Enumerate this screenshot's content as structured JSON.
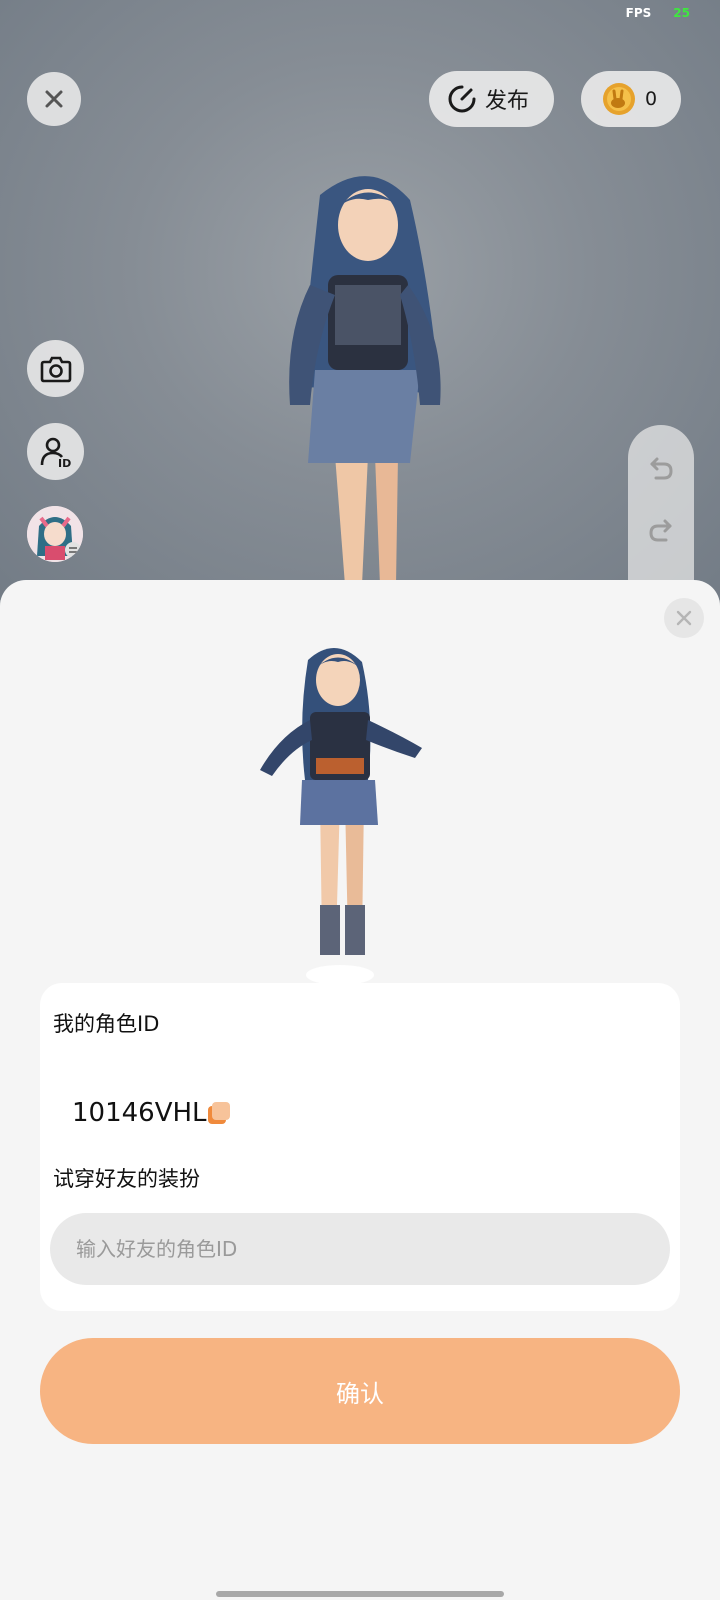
{
  "status": {
    "fps_label": "FPS",
    "fps_value": "25"
  },
  "topbar": {
    "close_icon": "close-icon",
    "publish_label": "发布",
    "publish_icon": "publish-dial-icon",
    "coin_icon": "rabbit-coin-icon",
    "coin_count": "0"
  },
  "side_tools": {
    "camera_icon": "camera-icon",
    "role_id_icon": "user-id-icon",
    "avatar_switch_icon": "avatar-switch-icon"
  },
  "history": {
    "undo_icon": "undo-icon",
    "redo_icon": "redo-icon"
  },
  "sheet": {
    "close_icon": "close-icon",
    "my_id_label": "我的角色ID",
    "my_id_value": "10146VHL",
    "copy_icon": "copy-icon",
    "try_on_label": "试穿好友的装扮",
    "friend_id_placeholder": "输入好友的角色ID",
    "confirm_label": "确认"
  },
  "colors": {
    "accent_orange": "#f7b482",
    "copy_orange": "#f08a3c",
    "fps_green": "#3ee83e"
  }
}
